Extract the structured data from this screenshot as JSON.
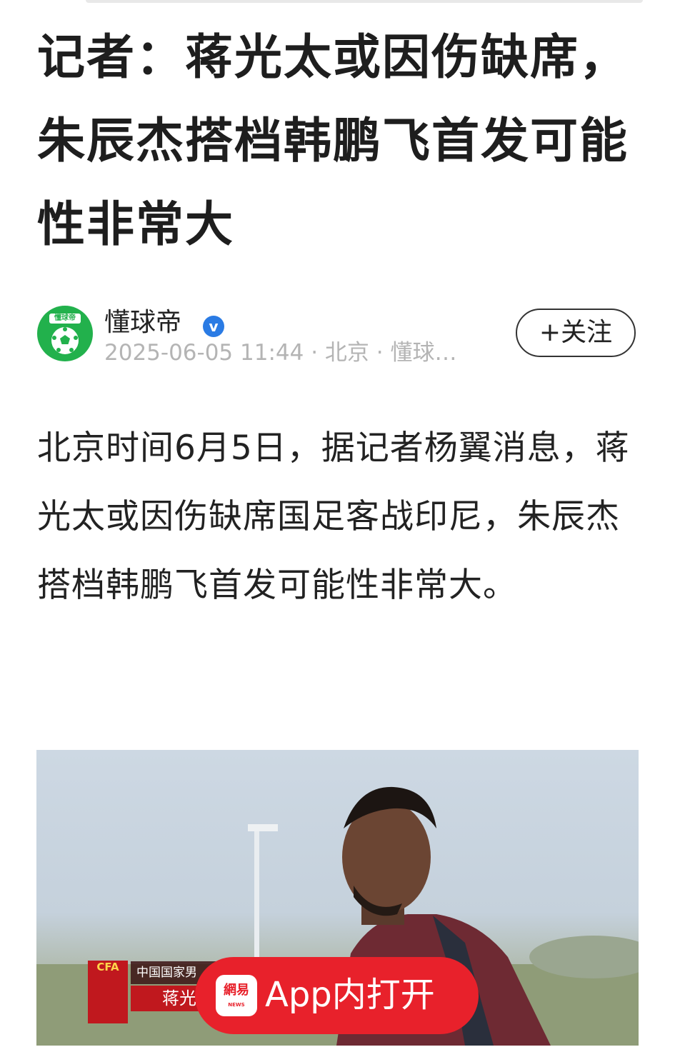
{
  "article": {
    "title": "记者：蒋光太或因伤缺席，朱辰杰搭档韩鹏飞首发可能性非常大",
    "body": "北京时间6月5日，据记者杨翼消息，蒋光太或因伤缺席国足客战印尼，朱辰杰搭档韩鹏飞首发可能性非常大。"
  },
  "author": {
    "avatar_tag": "懂球帝",
    "name": "懂球帝",
    "verified_mark": "v",
    "meta": "2025-06-05 11:44 · 北京 · 懂球…",
    "follow_label": "+关注"
  },
  "image": {
    "badge_text": "CFA",
    "caption_line1": "中国国家男",
    "caption_name": "蒋光"
  },
  "open_in_app": {
    "logo_text": "網易",
    "logo_subtext": "NEWS",
    "label": "App内打开"
  },
  "colors": {
    "brand_green": "#22b14c",
    "verified_blue": "#2a7be4",
    "app_red": "#e8212b",
    "meta_gray": "#b4b4b4"
  },
  "icons": [
    "football-icon",
    "verified-icon",
    "netease-news-icon"
  ]
}
